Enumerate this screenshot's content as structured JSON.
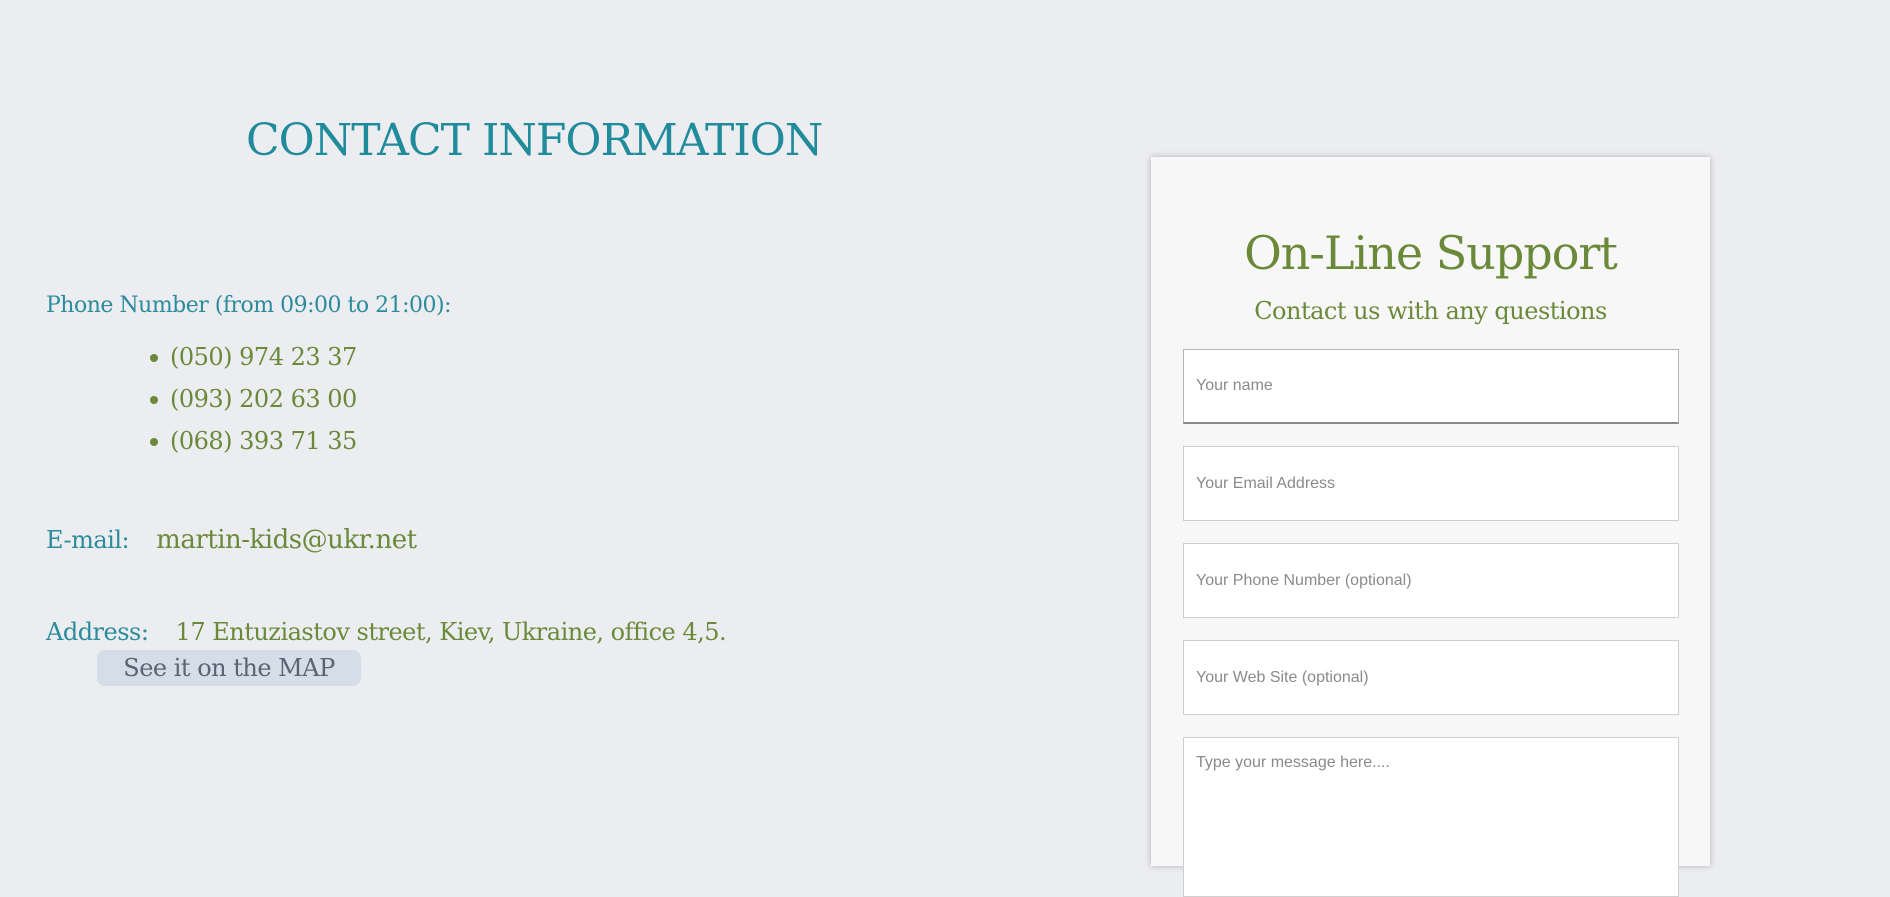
{
  "contact": {
    "title": "CONTACT INFORMATION",
    "phone_label": "Phone Number (from 09:00 to 21:00):",
    "phones": [
      "(050) 974 23 37",
      "(093) 202 63 00",
      "(068) 393 71 35"
    ],
    "email_label": "E-mail:",
    "email": "martin-kids@ukr.net",
    "address_label": "Address:",
    "address": "17 Entuziastov street, Kiev, Ukraine, office 4,5.",
    "map_button": "See it on the MAP"
  },
  "support": {
    "title": "On-Line Support",
    "subtitle": "Contact us with any questions",
    "name_placeholder": "Your name",
    "email_placeholder": "Your Email Address",
    "phone_placeholder": "Your Phone Number (optional)",
    "website_placeholder": "Your Web Site (optional)",
    "message_placeholder": "Type your message here...."
  },
  "colors": {
    "background": "#ecedf1",
    "teal_text": "#1f8b9b",
    "green_text": "#6a8a3a",
    "map_button_bg": "#d5dde9",
    "panel_bg": "#f7f7f7"
  }
}
